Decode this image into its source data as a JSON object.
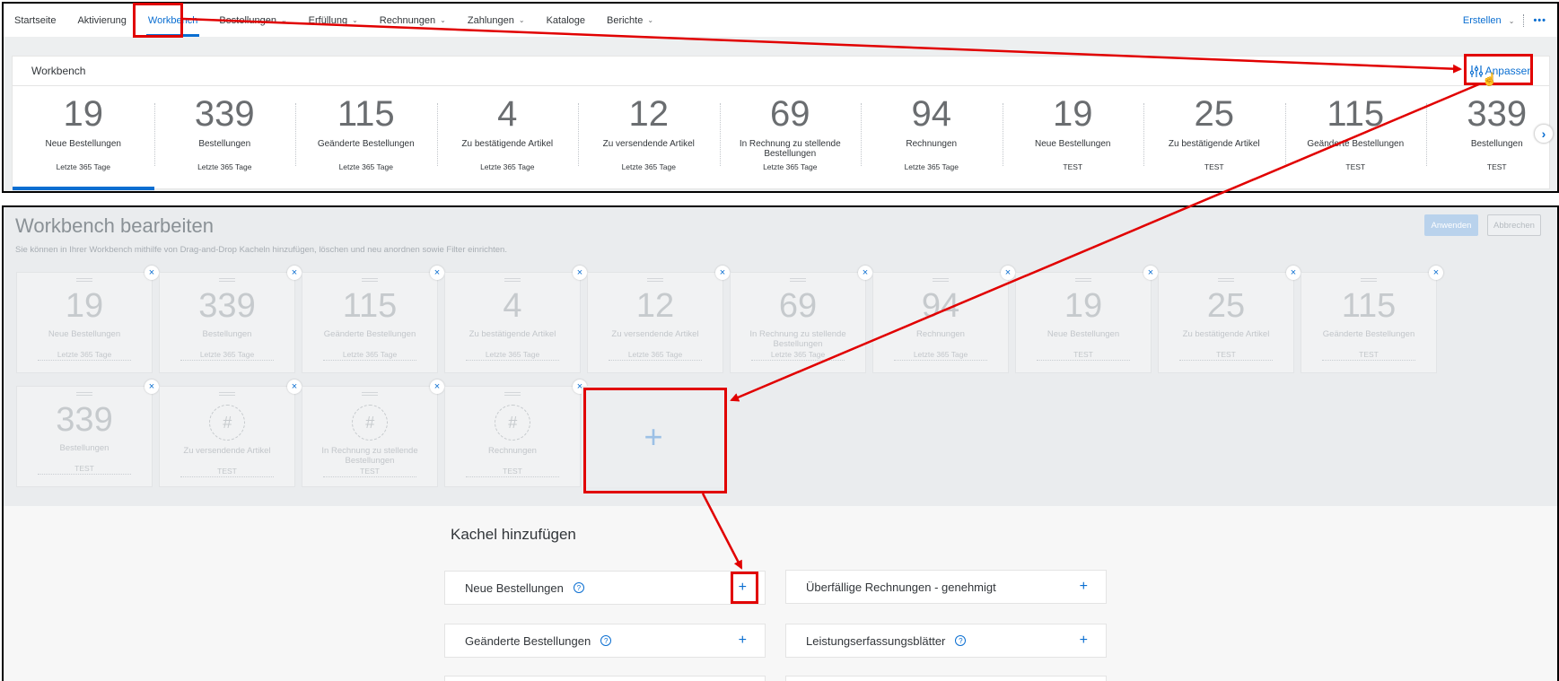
{
  "nav": {
    "items": [
      {
        "label": "Startseite",
        "chevron": false
      },
      {
        "label": "Aktivierung",
        "chevron": false
      },
      {
        "label": "Workbench",
        "chevron": false,
        "active": true
      },
      {
        "label": "Bestellungen",
        "chevron": true
      },
      {
        "label": "Erfüllung",
        "chevron": true
      },
      {
        "label": "Rechnungen",
        "chevron": true
      },
      {
        "label": "Zahlungen",
        "chevron": true
      },
      {
        "label": "Kataloge",
        "chevron": false
      },
      {
        "label": "Berichte",
        "chevron": true
      }
    ],
    "create_label": "Erstellen",
    "more_label": "•••"
  },
  "workbench": {
    "title": "Workbench",
    "customize_label": "Anpassen",
    "tiles": [
      {
        "value": "19",
        "label": "Neue Bestellungen",
        "filter": "Letzte 365 Tage"
      },
      {
        "value": "339",
        "label": "Bestellungen",
        "filter": "Letzte 365 Tage"
      },
      {
        "value": "115",
        "label": "Geänderte Bestellungen",
        "filter": "Letzte 365 Tage"
      },
      {
        "value": "4",
        "label": "Zu bestätigende Artikel",
        "filter": "Letzte 365 Tage"
      },
      {
        "value": "12",
        "label": "Zu versendende Artikel",
        "filter": "Letzte 365 Tage"
      },
      {
        "value": "69",
        "label": "In Rechnung zu stellende Bestellungen",
        "filter": "Letzte 365 Tage"
      },
      {
        "value": "94",
        "label": "Rechnungen",
        "filter": "Letzte 365 Tage"
      },
      {
        "value": "19",
        "label": "Neue Bestellungen",
        "filter": "TEST"
      },
      {
        "value": "25",
        "label": "Zu bestätigende Artikel",
        "filter": "TEST"
      },
      {
        "value": "115",
        "label": "Geänderte Bestellungen",
        "filter": "TEST"
      },
      {
        "value": "339",
        "label": "Bestellungen",
        "filter": "TEST"
      }
    ]
  },
  "edit": {
    "title": "Workbench bearbeiten",
    "description": "Sie können in Ihrer Workbench mithilfe von Drag-and-Drop Kacheln hinzufügen, löschen und neu anordnen sowie Filter einrichten.",
    "apply_label": "Anwenden",
    "cancel_label": "Abbrechen",
    "row1": [
      {
        "value": "19",
        "label": "Neue Bestellungen",
        "filter": "Letzte 365 Tage"
      },
      {
        "value": "339",
        "label": "Bestellungen",
        "filter": "Letzte 365 Tage"
      },
      {
        "value": "115",
        "label": "Geänderte Bestellungen",
        "filter": "Letzte 365 Tage"
      },
      {
        "value": "4",
        "label": "Zu bestätigende Artikel",
        "filter": "Letzte 365 Tage"
      },
      {
        "value": "12",
        "label": "Zu versendende Artikel",
        "filter": "Letzte 365 Tage"
      },
      {
        "value": "69",
        "label": "In Rechnung zu stellende Bestellungen",
        "filter": "Letzte 365 Tage"
      },
      {
        "value": "94",
        "label": "Rechnungen",
        "filter": "Letzte 365 Tage"
      },
      {
        "value": "19",
        "label": "Neue Bestellungen",
        "filter": "TEST"
      },
      {
        "value": "25",
        "label": "Zu bestätigende Artikel",
        "filter": "TEST"
      },
      {
        "value": "115",
        "label": "Geänderte Bestellungen",
        "filter": "TEST"
      }
    ],
    "row2": [
      {
        "value": "339",
        "label": "Bestellungen",
        "filter": "TEST"
      },
      {
        "value": "#",
        "label": "Zu versendende Artikel",
        "filter": "TEST"
      },
      {
        "value": "#",
        "label": "In Rechnung zu stellende Bestellungen",
        "filter": "TEST"
      },
      {
        "value": "#",
        "label": "Rechnungen",
        "filter": "TEST"
      }
    ],
    "remove_symbol": "×",
    "add_symbol": "+"
  },
  "add_tiles": {
    "title": "Kachel hinzufügen",
    "items": [
      {
        "label": "Neue Bestellungen",
        "help": true
      },
      {
        "label": "Überfällige Rechnungen - genehmigt",
        "help": false
      },
      {
        "label": "Geänderte Bestellungen",
        "help": true
      },
      {
        "label": "Leistungserfassungsblätter",
        "help": true
      }
    ]
  },
  "colors": {
    "accent": "#0a6ed1",
    "annotation": "#e10000"
  }
}
